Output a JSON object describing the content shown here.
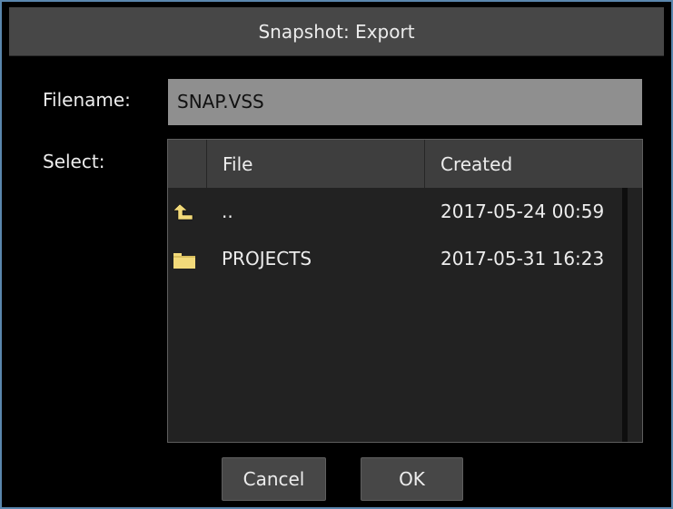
{
  "dialog": {
    "title": "Snapshot: Export",
    "border_color": "#5a86ad"
  },
  "filename": {
    "label": "Filename:",
    "value": "SNAP.VSS"
  },
  "select": {
    "label": "Select:"
  },
  "file_list": {
    "columns": [
      "File",
      "Created"
    ],
    "rows": [
      {
        "icon": "parent-directory-icon",
        "name": "..",
        "created": "2017-05-24 00:59"
      },
      {
        "icon": "folder-icon",
        "name": "PROJECTS",
        "created": "2017-05-31 16:23"
      }
    ]
  },
  "buttons": {
    "cancel": "Cancel",
    "ok": "OK"
  },
  "colors": {
    "folder": "#f2da7a",
    "background": "#000000",
    "panel": "#222222"
  }
}
